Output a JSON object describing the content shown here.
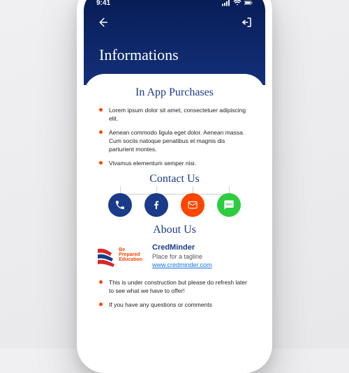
{
  "status": {
    "time": "9:41"
  },
  "page": {
    "title": "Informations"
  },
  "sections": {
    "purchases": {
      "heading": "In App Purchases",
      "items": [
        "Lorem ipsum dolor sit amet, consectetuer adipiscing elit.",
        "Aenean commodo ligula eget dolor. Aenean massa. Cum sociis natoque penatibus et magnis dis parturient montes.",
        "Vivamus elementum semper nisi."
      ]
    },
    "contact": {
      "heading": "Contact Us"
    },
    "about": {
      "heading": "About Us",
      "logo_line1": "Be",
      "logo_line2": "Prepared",
      "logo_line3": "Education",
      "brand": "CredMinder",
      "tagline": "Place for a tagline",
      "url": "www.credminder.com",
      "items": [
        "This is under construction but please do refresh later to see what we have to offer!",
        "If you have any questions or comments"
      ]
    }
  }
}
